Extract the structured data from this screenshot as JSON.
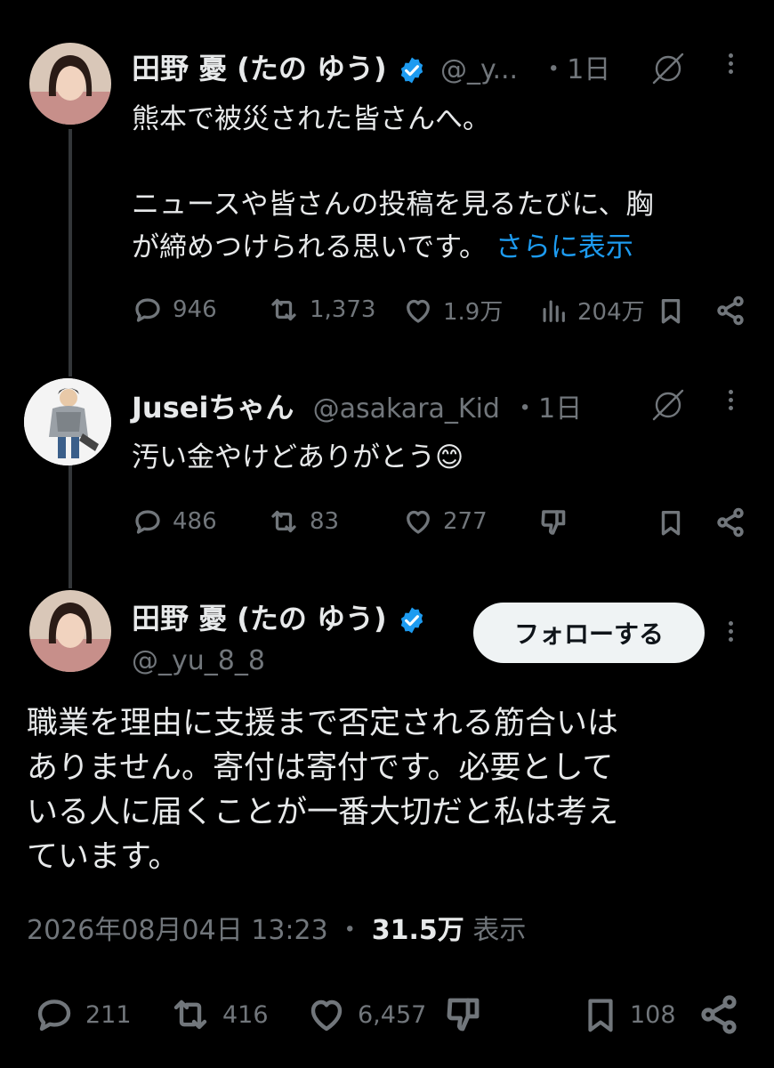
{
  "tweet1": {
    "name": "田野 憂 (たの ゆう)",
    "handle": "@_y...",
    "time": "・1日",
    "text": "熊本で被災された皆さんへ。\n\nニュースや皆さんの投稿を見るたびに、胸\nが締めつけられる思いです。",
    "show_more": "さらに表示",
    "replies": "946",
    "reposts": "1,373",
    "likes": "1.9万",
    "views": "204万"
  },
  "tweet2": {
    "name": "Juseiちゃん",
    "handle": "@asakara_Kid",
    "time": "・1日",
    "text": "汚い金やけどありがとう😊",
    "replies": "486",
    "reposts": "83",
    "likes": "277"
  },
  "tweet3": {
    "name": "田野 憂 (たの ゆう)",
    "handle": "@_yu_8_8",
    "follow_label": "フォローする",
    "text": "職業を理由に支援まで否定される筋合いは\nありません。寄付は寄付です。必要として\nいる人に届くことが一番大切だと私は考え\nています。",
    "timestamp": "2026年08月04日 13:23",
    "separator": "・",
    "views_count": "31.5万",
    "views_label": "表示",
    "replies": "211",
    "reposts": "416",
    "likes": "6,457",
    "bookmarks": "108"
  },
  "colors": {
    "background": "#000000",
    "text": "#e7e9ea",
    "muted": "#71767b",
    "link": "#1d9bf0",
    "verified": "#1d9bf0"
  },
  "icons": [
    "grok-icon",
    "more-icon",
    "reply-icon",
    "repost-icon",
    "like-icon",
    "views-icon",
    "bookmark-icon",
    "share-icon",
    "dislike-icon",
    "verified-badge-icon"
  ]
}
